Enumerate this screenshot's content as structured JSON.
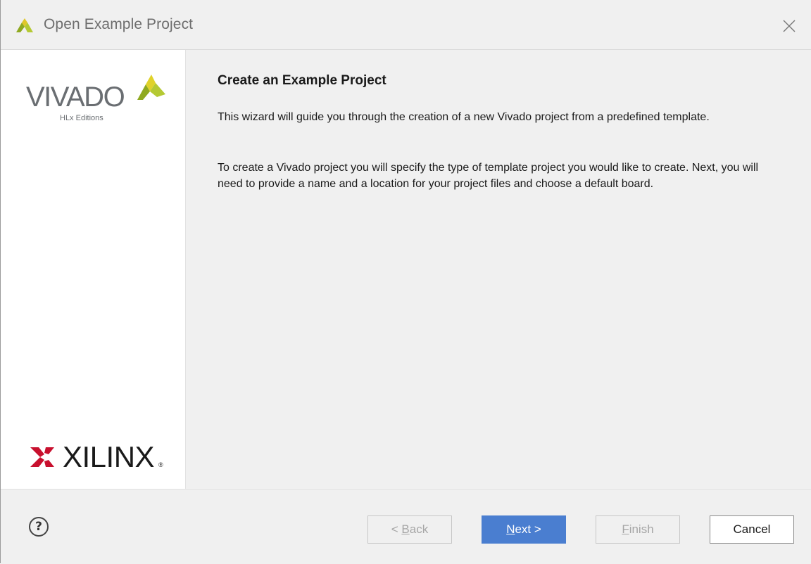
{
  "window": {
    "title": "Open Example Project",
    "icon": "vivado-logo-icon",
    "close_icon": "close-icon"
  },
  "sidebar": {
    "vivado_word": "VIVADO",
    "vivado_subtitle": "HLx Editions",
    "xilinx_word": "XILINX",
    "xilinx_registered": "®"
  },
  "content": {
    "heading": "Create an Example Project",
    "paragraph1": "This wizard will guide you through the creation of a new Vivado project from a predefined template.",
    "paragraph2": "To create a Vivado project you will specify the type of template project you would like to create. Next, you will need to provide a name and a location for your project files and choose a default board."
  },
  "footer": {
    "help_label": "?",
    "back": {
      "prefix": "< ",
      "mnemonic": "B",
      "rest": "ack",
      "enabled": false
    },
    "next": {
      "mnemonic": "N",
      "rest": "ext >",
      "enabled": true
    },
    "finish": {
      "mnemonic": "F",
      "rest": "inish",
      "enabled": false
    },
    "cancel": {
      "label": "Cancel",
      "enabled": true
    }
  },
  "colors": {
    "accent": "#4a7ed0",
    "vivado_green": "#b5c933",
    "vivado_yellow": "#e0d22a",
    "xilinx_red": "#c8102e"
  }
}
